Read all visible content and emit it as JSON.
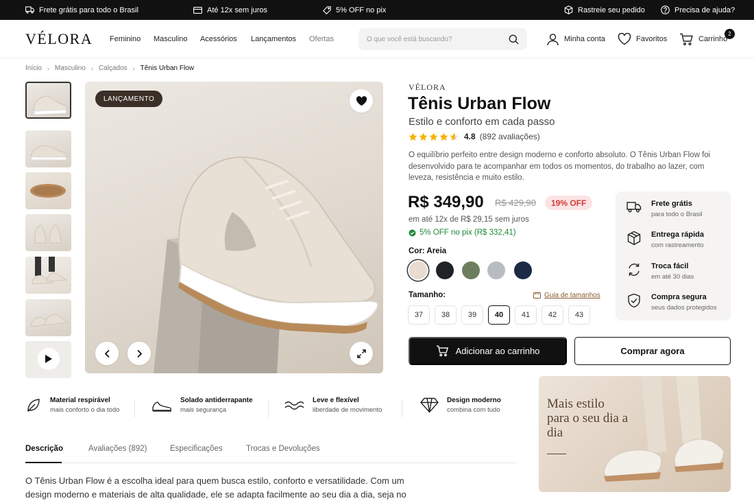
{
  "topbar": {
    "free_shipping": "Frete grátis para todo o Brasil",
    "installments": "Até 12x sem juros",
    "pix_discount": "5% OFF no pix",
    "track_order": "Rastreie seu pedido",
    "help": "Precisa de ajuda?"
  },
  "header": {
    "logo": "VÉLORA",
    "nav": [
      "Feminino",
      "Masculino",
      "Acessórios",
      "Lançamentos",
      "Ofertas"
    ],
    "search_placeholder": "O que você está buscando?",
    "account": "Minha conta",
    "favorites": "Favoritos",
    "cart": "Carrinho",
    "cart_count": "2"
  },
  "breadcrumb": [
    "Início",
    "Masculino",
    "Calçados",
    "Tênis Urban Flow"
  ],
  "gallery": {
    "badge": "LANÇAMENTO",
    "thumbnails": [
      "shoe-side",
      "shoe-side-flat",
      "shoe-sole",
      "shoe-back",
      "shoe-worn",
      "shoe-pair",
      "video"
    ]
  },
  "product": {
    "brand": "VÉLORA",
    "title": "Tênis Urban Flow",
    "subtitle": "Estilo e conforto em cada passo",
    "rating": "4.8",
    "reviews": "(892 avaliações)",
    "rating_stars": 4.8,
    "description": "O equilíbrio perfeito entre design moderno e conforto absoluto. O Tênis Urban Flow foi desenvolvido para te acompanhar em todos os momentos, do trabalho ao lazer, com leveza, resistência e muito estilo.",
    "price": "R$ 349,90",
    "old_price": "R$ 429,90",
    "discount": "19% OFF",
    "installments": "em até 12x de R$ 29,15 sem juros",
    "pix": "5% OFF no pix (R$ 332,41)",
    "color_label": "Cor: Areia",
    "colors": [
      {
        "name": "Areia",
        "hex": "#e7dccf"
      },
      {
        "name": "Preto",
        "hex": "#1f2326"
      },
      {
        "name": "Verde",
        "hex": "#6b7f5e"
      },
      {
        "name": "Cinza",
        "hex": "#b9bcc0"
      },
      {
        "name": "Azul marinho",
        "hex": "#1c2b45"
      }
    ],
    "size_label": "Tamanho:",
    "size_guide": "Guia de tamanhos",
    "sizes": [
      "37",
      "38",
      "39",
      "40",
      "41",
      "42",
      "43"
    ],
    "selected_size": "40",
    "add_to_cart": "Adicionar ao carrinho",
    "buy_now": "Comprar agora"
  },
  "benefits": [
    {
      "title": "Frete grátis",
      "sub": "para todo o Brasil",
      "icon": "truck-icon"
    },
    {
      "title": "Entrega rápida",
      "sub": "com rastreamento",
      "icon": "box-icon"
    },
    {
      "title": "Troca fácil",
      "sub": "em até 30 dias",
      "icon": "exchange-icon"
    },
    {
      "title": "Compra segura",
      "sub": "seus dados protegidos",
      "icon": "shield-icon"
    }
  ],
  "features": [
    {
      "title": "Material respirável",
      "sub": "mais conforto o dia todo",
      "icon": "leaf-icon"
    },
    {
      "title": "Solado antiderrapante",
      "sub": "mais segurança",
      "icon": "shoe-icon"
    },
    {
      "title": "Leve e flexível",
      "sub": "liberdade de movimento",
      "icon": "waves-icon"
    },
    {
      "title": "Design moderno",
      "sub": "combina com tudo",
      "icon": "diamond-icon"
    }
  ],
  "tabs": [
    "Descrição",
    "Avaliações (892)",
    "Especificações",
    "Trocas e Devoluções"
  ],
  "description_text": "O Tênis Urban Flow é a escolha ideal para quem busca estilo, conforto e versatilidade. Com um design moderno e materiais de alta qualidade, ele se adapta facilmente ao seu dia a dia, seja no trabalho, nos",
  "promo": {
    "text": "Mais estilo para o seu dia a dia"
  },
  "colors": {
    "accent": "#111111",
    "discount_bg": "#fde4e4",
    "discount_fg": "#d13b3b",
    "pix": "#1f8a3a",
    "star": "#f5b301",
    "badge_bg": "#3b2f27"
  }
}
